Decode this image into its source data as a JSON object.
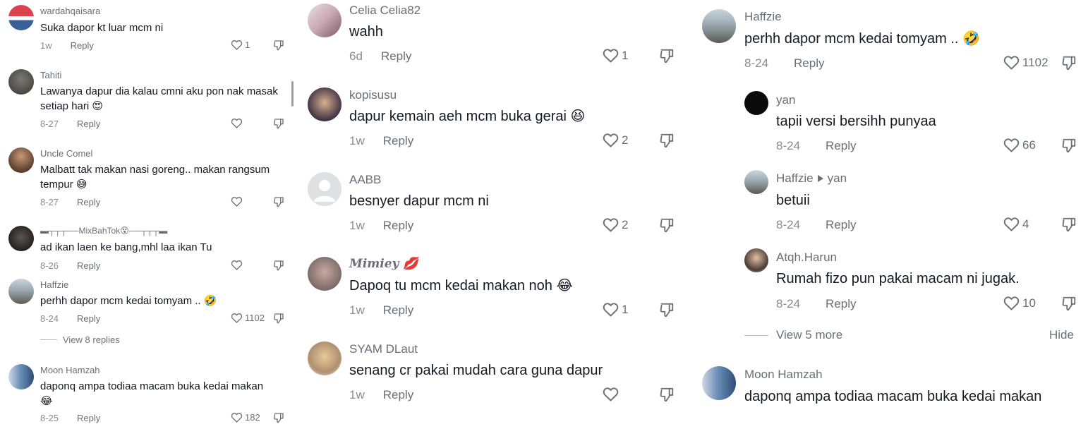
{
  "colors": {
    "text": "#161823",
    "secondary": "#6b6e78",
    "muted": "#8a8b91",
    "background": "#ffffff"
  },
  "panel_left": {
    "comments": [
      {
        "username": "wardahqaisara",
        "text": "Suka dapor kt luar mcm ni",
        "emoji": "",
        "time": "1w",
        "reply": "Reply",
        "likes": "1",
        "avatar": "flag-avatar"
      },
      {
        "username": "Tahiti",
        "text": "Lawanya dapur dia kalau cmni aku pon nak masak setiap hari",
        "emoji": "😍",
        "time": "8-27",
        "reply": "Reply",
        "likes": "",
        "avatar": "gray-avatar"
      },
      {
        "username": "Uncle Comel",
        "text": "Malbatt tak makan nasi goreng.. makan rangsum tempur",
        "emoji": "😅",
        "time": "8-27",
        "reply": "Reply",
        "likes": "",
        "avatar": "person-avatar"
      },
      {
        "username": "▬┬┬┬──MixBahTok😵──┬┬┬▬",
        "text": "ad ikan laen ke bang,mhl laa ikan Tu",
        "emoji": "",
        "time": "8-26",
        "reply": "Reply",
        "likes": "",
        "avatar": "dark-avatar"
      },
      {
        "username": "Haffzie",
        "text": "perhh dapor mcm kedai tomyam ..",
        "emoji": "🤣",
        "time": "8-24",
        "reply": "Reply",
        "likes": "1102",
        "avatar": "beach-avatar"
      },
      {
        "username": "Moon Hamzah",
        "text": "daponq ampa todiaa macam buka kedai makan",
        "emoji": "😂",
        "time": "8-25",
        "reply": "Reply",
        "likes": "182",
        "avatar": "couple-avatar"
      }
    ],
    "view_replies": "View 8 replies"
  },
  "panel_mid": {
    "comments": [
      {
        "username": "Celia Celia82",
        "text": "wahh",
        "emoji": "",
        "time": "6d",
        "reply": "Reply",
        "likes": "1"
      },
      {
        "username": "kopisusu",
        "text": "dapur kemain aeh mcm buka gerai",
        "emoji": "😆",
        "time": "1w",
        "reply": "Reply",
        "likes": "2"
      },
      {
        "username": "AABB",
        "text": "besnyer dapur mcm ni",
        "emoji": "",
        "time": "1w",
        "reply": "Reply",
        "likes": "2"
      },
      {
        "username": "Mimiey",
        "username_emoji": "💋",
        "text": "Dapoq tu mcm kedai makan noh",
        "emoji": "😂",
        "time": "1w",
        "reply": "Reply",
        "likes": "1"
      },
      {
        "username": "SYAM DLaut",
        "text": "senang cr pakai mudah cara guna dapur",
        "emoji": "",
        "time": "1w",
        "reply": "Reply",
        "likes": ""
      }
    ]
  },
  "panel_right": {
    "comments": [
      {
        "username": "Haffzie",
        "text": "perhh dapor mcm kedai tomyam ..",
        "emoji": "🤣",
        "time": "8-24",
        "reply": "Reply",
        "likes": "1102"
      },
      {
        "username": "yan",
        "text": "tapii versi bersihh punyaa",
        "emoji": "",
        "time": "8-24",
        "reply": "Reply",
        "likes": "66"
      },
      {
        "username": "Haffzie",
        "reply_to": "yan",
        "text": "betuii",
        "emoji": "",
        "time": "8-24",
        "reply": "Reply",
        "likes": "4"
      },
      {
        "username": "Atqh.Harun",
        "text": "Rumah fizo pun pakai macam ni jugak.",
        "emoji": "",
        "time": "8-24",
        "reply": "Reply",
        "likes": "10"
      },
      {
        "username": "Moon Hamzah",
        "text": "daponq ampa todiaa macam buka kedai makan",
        "emoji": "",
        "time": "",
        "reply": "",
        "likes": ""
      }
    ],
    "view_more": "View 5 more",
    "hide": "Hide"
  },
  "icons": {
    "like": "heart-outline-icon",
    "dislike": "thumbs-down-icon",
    "reply_arrow": "play-triangle-icon",
    "default_avatar": "person-silhouette-icon"
  }
}
